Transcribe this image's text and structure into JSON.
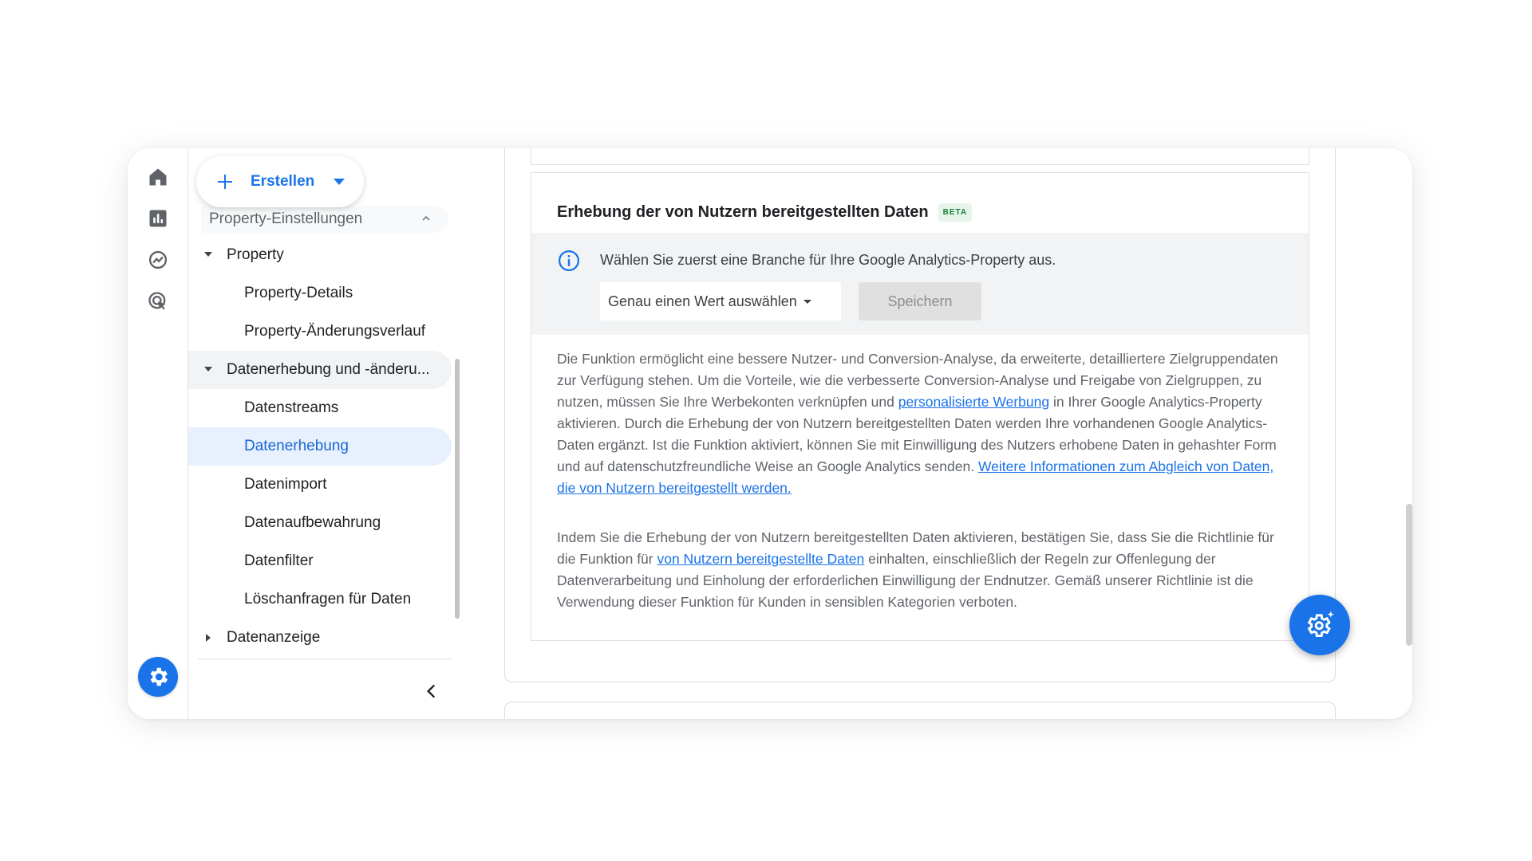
{
  "create_button": {
    "label": "Erstellen"
  },
  "nav": {
    "section_title": "Property-Einstellungen",
    "items": [
      {
        "label": "Property",
        "level": 1,
        "expanded": true
      },
      {
        "label": "Property-Details",
        "level": 2
      },
      {
        "label": "Property-Änderungsverlauf",
        "level": 2
      },
      {
        "label": "Datenerhebung und -änderu...",
        "level": 1,
        "expanded": true
      },
      {
        "label": "Datenstreams",
        "level": 2
      },
      {
        "label": "Datenerhebung",
        "level": 2,
        "selected": true
      },
      {
        "label": "Datenimport",
        "level": 2
      },
      {
        "label": "Datenaufbewahrung",
        "level": 2
      },
      {
        "label": "Datenfilter",
        "level": 2
      },
      {
        "label": "Löschanfragen für Daten",
        "level": 2
      },
      {
        "label": "Datenanzeige",
        "level": 1,
        "expanded": false
      }
    ]
  },
  "card": {
    "title": "Erhebung der von Nutzern bereitgestellten Daten",
    "badge": "BETA",
    "banner_text": "Wählen Sie zuerst eine Branche für Ihre Google Analytics-Property aus.",
    "select_value": "Genau einen Wert auswählen",
    "save_label": "Speichern",
    "para1": {
      "t1": "Die Funktion ermöglicht eine bessere Nutzer- und Conversion-Analyse, da erweiterte, detailliertere Zielgruppendaten zur Verfügung stehen. Um die Vorteile, wie die verbesserte Conversion-Analyse und Freigabe von Zielgruppen, zu nutzen, müssen Sie Ihre Werbekonten verknüpfen und ",
      "link1": "personalisierte Werbung",
      "t2": " in Ihrer Google Analytics-Property aktivieren. Durch die Erhebung der von Nutzern bereitgestellten Daten werden Ihre vorhandenen Google Analytics-Daten ergänzt. Ist die Funktion aktiviert, können Sie mit Einwilligung des Nutzers erhobene Daten in gehashter Form und auf datenschutzfreundliche Weise an Google Analytics senden. ",
      "link2": "Weitere Informationen zum Abgleich von Daten, die von Nutzern bereitgestellt werden."
    },
    "para2": {
      "t1": "Indem Sie die Erhebung der von Nutzern bereitgestellten Daten aktivieren, bestätigen Sie, dass Sie die Richtlinie für die Funktion für ",
      "link1": "von Nutzern bereitgestellte Daten",
      "t2": " einhalten, einschließlich der Regeln zur Offenlegung der Datenverarbeitung und Einholung der erforderlichen Einwilligung der Endnutzer. Gemäß unserer Richtlinie ist die Verwendung dieser Funktion für Kunden in sensiblen Kategorien verboten."
    }
  },
  "colors": {
    "accent": "#1a73e8",
    "selected_bg": "#e8f0fe",
    "beta_bg": "#e6f4ea",
    "beta_text": "#188038"
  },
  "icons": [
    "home-icon",
    "bar-chart-icon",
    "explore-icon",
    "advertising-icon",
    "settings-gear-icon",
    "plus-icon",
    "chevron-up-icon",
    "chevron-left-icon",
    "info-icon",
    "sparkle-gear-icon"
  ]
}
